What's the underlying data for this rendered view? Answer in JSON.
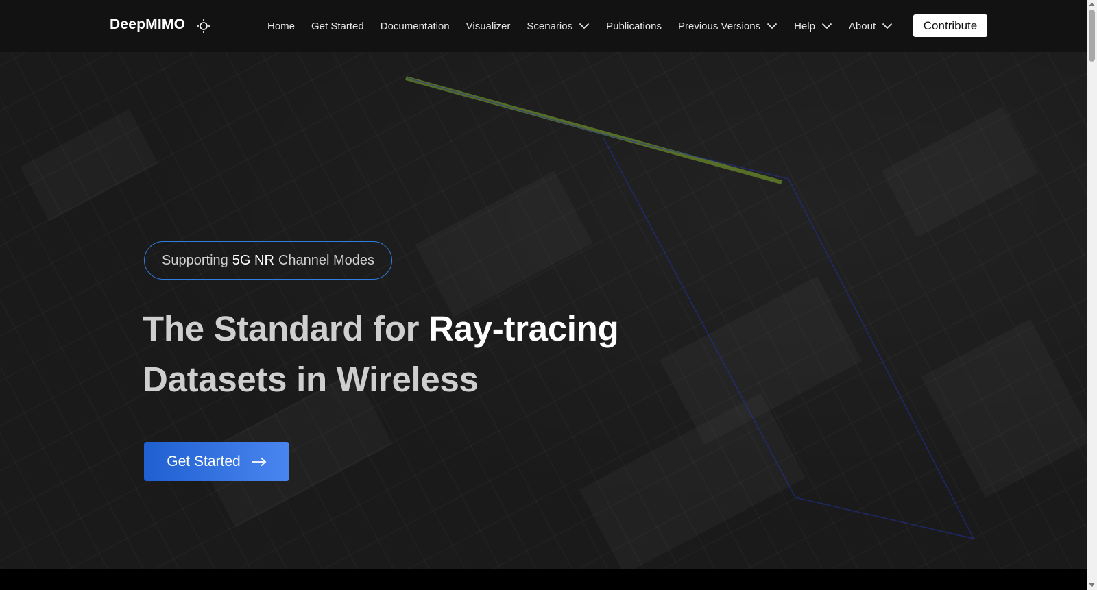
{
  "app": {
    "brand": "DeepMIMO"
  },
  "navbar": {
    "items": [
      {
        "label": "Home",
        "has_dropdown": false
      },
      {
        "label": "Get Started",
        "has_dropdown": false
      },
      {
        "label": "Documentation",
        "has_dropdown": false
      },
      {
        "label": "Visualizer",
        "has_dropdown": false
      },
      {
        "label": "Scenarios",
        "has_dropdown": true
      },
      {
        "label": "Publications",
        "has_dropdown": false
      },
      {
        "label": "Previous Versions",
        "has_dropdown": true
      },
      {
        "label": "Help",
        "has_dropdown": true
      },
      {
        "label": "About",
        "has_dropdown": true
      }
    ],
    "contribute_label": "Contribute",
    "theme_icon": "sun-icon"
  },
  "hero": {
    "badge": {
      "prefix": "Supporting",
      "highlight": "5G NR",
      "suffix": "Channel Modes"
    },
    "headline": {
      "part1": "The Standard for",
      "accent": "Ray-tracing",
      "line2": "Datasets in Wireless"
    },
    "cta_label": "Get Started",
    "cta_icon": "arrow-right-icon"
  },
  "colors": {
    "navbar_bg": "#121212",
    "badge_border": "#2f7de0",
    "cta_start": "#1f5fd0",
    "cta_end": "#4a86f0",
    "ray_path": "#9acd32",
    "ray_outline": "#2233aa"
  }
}
